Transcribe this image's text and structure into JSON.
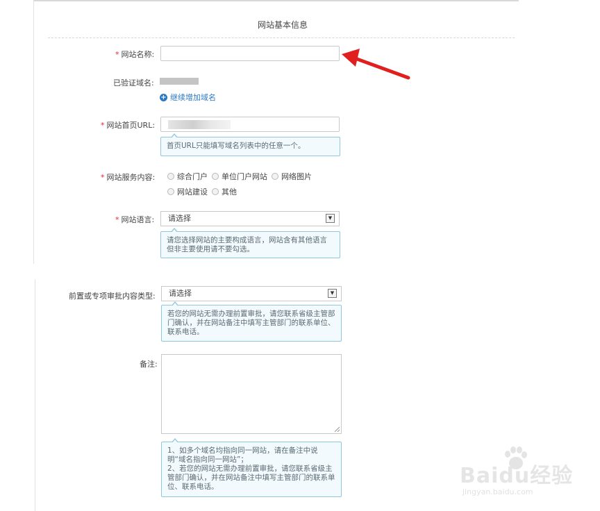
{
  "section_title": "网站基本信息",
  "required_mark": "*",
  "fields": {
    "site_name": {
      "label": "网站名称:",
      "value": ""
    },
    "verified_domain": {
      "label": "已验证域名:"
    },
    "add_domain": {
      "label": "继续增加域名"
    },
    "homepage_url": {
      "label": "网站首页URL:",
      "tip": "首页URL只能填写域名列表中的任意一个。"
    },
    "service_content": {
      "label": "网站服务内容:",
      "options": [
        "综合门户",
        "单位门户网站",
        "网络图片",
        "网站建设",
        "其他"
      ]
    },
    "site_language": {
      "label": "网站语言:",
      "selected": "请选择",
      "tip": "请您选择网站的主要构成语言，网站含有其他语言但非主要使用请不要勾选。"
    },
    "approval_type": {
      "label": "前置或专项审批内容类型:",
      "selected": "请选择",
      "tip": "若您的网站无需办理前置审批，请您联系省级主管部门确认，并在网站备注中填写主管部门的联系单位、联系电话。"
    },
    "remarks": {
      "label": "备注:",
      "value": "",
      "tip_line1": "1、如多个域名均指向同一网站，请在备注中说明“域名指向同一网站”；",
      "tip_line2": "2、若您的网站无需办理前置审批，请您联系省级主管部门确认，并在网站备注中填写主管部门的联系单位、联系电话。"
    }
  },
  "watermark": {
    "brand": "Baidu经验",
    "url": "jingyan.baidu.com"
  },
  "colors": {
    "required": "#e22233",
    "link": "#2a78c0",
    "tip_border": "#8fc7df",
    "arrow": "#e0201f"
  }
}
